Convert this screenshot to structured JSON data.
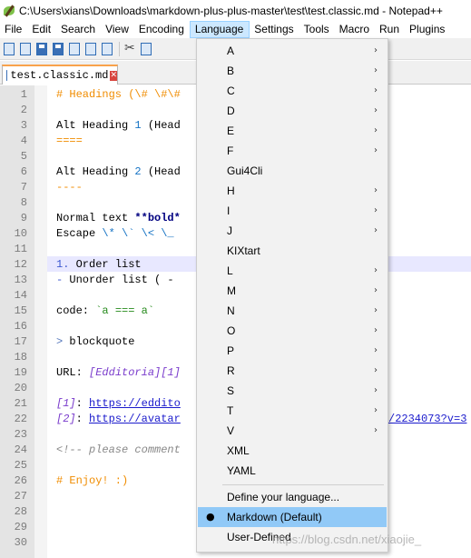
{
  "window": {
    "title": "C:\\Users\\xians\\Downloads\\markdown-plus-plus-master\\test\\test.classic.md - Notepad++"
  },
  "menubar": {
    "items": [
      "File",
      "Edit",
      "Search",
      "View",
      "Encoding",
      "Language",
      "Settings",
      "Tools",
      "Macro",
      "Run",
      "Plugins"
    ]
  },
  "tab": {
    "label": "test.classic.md",
    "close_icon": "close-icon"
  },
  "editor": {
    "lines": [
      {
        "n": "1"
      },
      {
        "n": "2"
      },
      {
        "n": "3"
      },
      {
        "n": "4"
      },
      {
        "n": "5"
      },
      {
        "n": "6"
      },
      {
        "n": "7"
      },
      {
        "n": "8"
      },
      {
        "n": "9"
      },
      {
        "n": "10"
      },
      {
        "n": "11"
      },
      {
        "n": "12"
      },
      {
        "n": "13"
      },
      {
        "n": "14"
      },
      {
        "n": "15"
      },
      {
        "n": "16"
      },
      {
        "n": "17"
      },
      {
        "n": "18"
      },
      {
        "n": "19"
      },
      {
        "n": "20"
      },
      {
        "n": "21"
      },
      {
        "n": "22"
      },
      {
        "n": "23"
      },
      {
        "n": "24"
      },
      {
        "n": "25"
      },
      {
        "n": "26"
      },
      {
        "n": "27"
      },
      {
        "n": "28"
      },
      {
        "n": "29"
      },
      {
        "n": "30"
      }
    ],
    "code": {
      "l1": "# Headings (\\# \\#\\#",
      "l3a": "Alt Heading ",
      "l3b": "1",
      "l3c": " (Head",
      "l4": "====",
      "l6a": "Alt Heading ",
      "l6b": "2",
      "l6c": " (Head",
      "l7": "----",
      "l9a": "Normal text ",
      "l9b": "**bold*",
      "l10a": "Escape ",
      "l10b": "\\* \\` \\< \\_",
      "l12a": "1.",
      "l12b": " Order list",
      "l13a": "-",
      "l13b": " Unorder list ( -",
      "l15a": "code: ",
      "l15b": "`a === a`",
      "l17a": ">",
      "l17b": " blockquote",
      "l19a": "URL: ",
      "l19b": "[Edditoria][1]",
      "l21a": "[1]",
      "l21b": ": ",
      "l21c": "https://eddito",
      "l22a": "[2]",
      "l22b": ": ",
      "l22c": "https://avatar",
      "l22d": "/2234073?v=3",
      "l24": "<!-- please comment",
      "l26": "# Enjoy! :)"
    }
  },
  "language_menu": {
    "items": [
      {
        "label": "A",
        "submenu": true
      },
      {
        "label": "B",
        "submenu": true
      },
      {
        "label": "C",
        "submenu": true
      },
      {
        "label": "D",
        "submenu": true
      },
      {
        "label": "E",
        "submenu": true
      },
      {
        "label": "F",
        "submenu": true
      },
      {
        "label": "Gui4Cli",
        "submenu": false
      },
      {
        "label": "H",
        "submenu": true
      },
      {
        "label": "I",
        "submenu": true
      },
      {
        "label": "J",
        "submenu": true
      },
      {
        "label": "KIXtart",
        "submenu": false
      },
      {
        "label": "L",
        "submenu": true
      },
      {
        "label": "M",
        "submenu": true
      },
      {
        "label": "N",
        "submenu": true
      },
      {
        "label": "O",
        "submenu": true
      },
      {
        "label": "P",
        "submenu": true
      },
      {
        "label": "R",
        "submenu": true
      },
      {
        "label": "S",
        "submenu": true
      },
      {
        "label": "T",
        "submenu": true
      },
      {
        "label": "V",
        "submenu": true
      },
      {
        "label": "XML",
        "submenu": false
      },
      {
        "label": "YAML",
        "submenu": false
      }
    ],
    "define_label": "Define your language...",
    "selected_label": "Markdown (Default)",
    "selected_bullet": "●",
    "user_defined_label": "User-Defined",
    "arrow_glyph": "›"
  },
  "watermark": "https://blog.csdn.net/xiaojie_",
  "colors": {
    "menu_highlight": "#91c9f7",
    "tab_accent": "#f9a24b",
    "current_line": "#e8e8ff"
  }
}
